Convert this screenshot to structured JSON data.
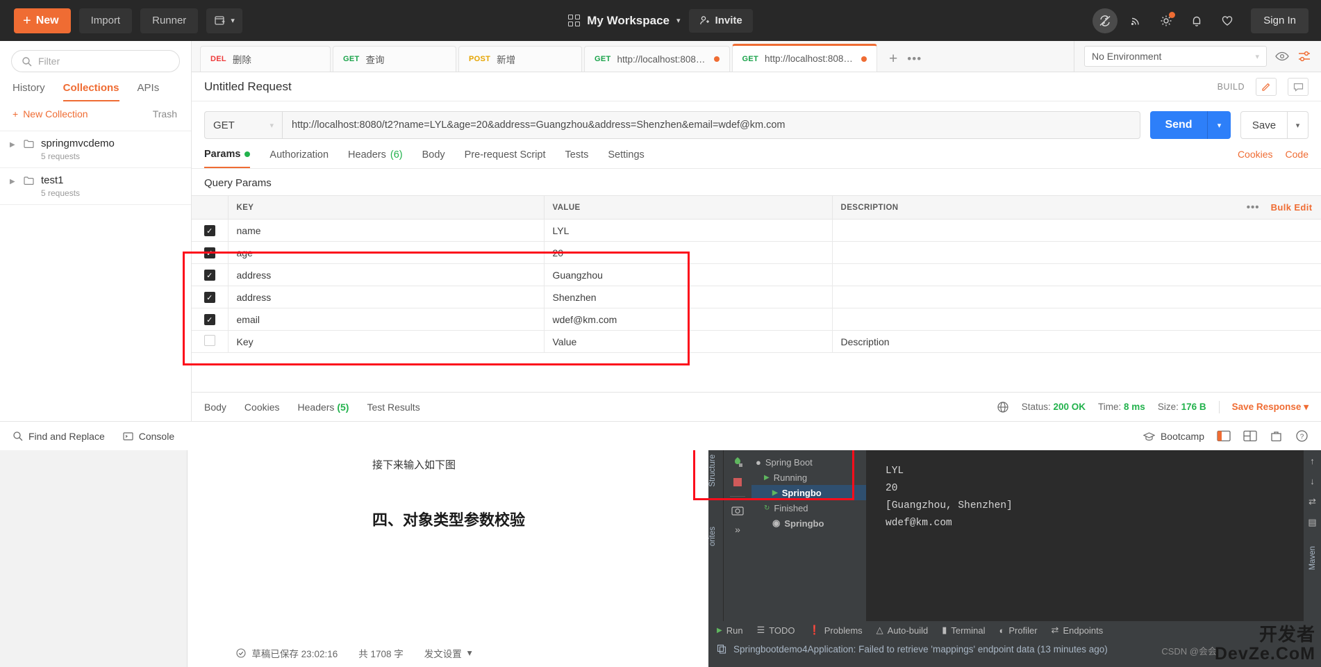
{
  "topbar": {
    "new_label": "New",
    "import_label": "Import",
    "runner_label": "Runner",
    "workspace_label": "My Workspace",
    "invite_label": "Invite",
    "signin_label": "Sign In",
    "icons": [
      "sync-off-icon",
      "broadcast-icon",
      "gear-icon",
      "bell-icon",
      "heart-icon"
    ],
    "accent_color": "#ef6c33",
    "background_color": "#282828"
  },
  "sidebar": {
    "filter_placeholder": "Filter",
    "tabs": [
      {
        "label": "History",
        "active": false
      },
      {
        "label": "Collections",
        "active": true
      },
      {
        "label": "APIs",
        "active": false
      }
    ],
    "new_collection_label": "New Collection",
    "trash_label": "Trash",
    "collections": [
      {
        "name": "springmvcdemo",
        "meta": "5 requests"
      },
      {
        "name": "test1",
        "meta": "5 requests"
      }
    ]
  },
  "request_tabs": [
    {
      "method": "DEL",
      "label": "删除",
      "active": false,
      "unsaved": false
    },
    {
      "method": "GET",
      "label": "查询",
      "active": false,
      "unsaved": false
    },
    {
      "method": "POST",
      "label": "新增",
      "active": false,
      "unsaved": false
    },
    {
      "method": "GET",
      "label": "http://localhost:8080/...",
      "active": false,
      "unsaved": true
    },
    {
      "method": "GET",
      "label": "http://localhost:8080/...",
      "active": true,
      "unsaved": true
    }
  ],
  "tab_add_label": "+",
  "tab_more_label": "•••",
  "environment": {
    "selected": "No Environment",
    "eye_icon": "eye-icon",
    "settings_icon": "sliders-icon"
  },
  "request": {
    "title": "Untitled Request",
    "build_label": "BUILD",
    "method": "GET",
    "url": "http://localhost:8080/t2?name=LYL&age=20&address=Guangzhou&address=Shenzhen&email=wdef@km.com",
    "send_label": "Send",
    "save_label": "Save",
    "tabs": [
      {
        "label": "Params",
        "active": true,
        "dot": true,
        "count": ""
      },
      {
        "label": "Authorization",
        "active": false,
        "dot": false,
        "count": ""
      },
      {
        "label": "Headers",
        "active": false,
        "dot": false,
        "count": "(6)"
      },
      {
        "label": "Body",
        "active": false,
        "dot": false,
        "count": ""
      },
      {
        "label": "Pre-request Script",
        "active": false,
        "dot": false,
        "count": ""
      },
      {
        "label": "Tests",
        "active": false,
        "dot": false,
        "count": ""
      },
      {
        "label": "Settings",
        "active": false,
        "dot": false,
        "count": ""
      }
    ],
    "cookies_label": "Cookies",
    "code_label": "Code"
  },
  "params": {
    "section_title": "Query Params",
    "columns": [
      "KEY",
      "VALUE",
      "DESCRIPTION"
    ],
    "bulk_edit_label": "Bulk Edit",
    "more_label": "•••",
    "rows": [
      {
        "checked": true,
        "key": "name",
        "value": "LYL",
        "description": ""
      },
      {
        "checked": true,
        "key": "age",
        "value": "20",
        "description": ""
      },
      {
        "checked": true,
        "key": "address",
        "value": "Guangzhou",
        "description": ""
      },
      {
        "checked": true,
        "key": "address",
        "value": "Shenzhen",
        "description": ""
      },
      {
        "checked": true,
        "key": "email",
        "value": "wdef@km.com",
        "description": ""
      }
    ],
    "empty_row": {
      "key": "Key",
      "value": "Value",
      "description": "Description"
    },
    "highlight_color": "#fc0d1b"
  },
  "response": {
    "tabs": [
      {
        "label": "Body",
        "count": ""
      },
      {
        "label": "Cookies",
        "count": ""
      },
      {
        "label": "Headers",
        "count": "(5)"
      },
      {
        "label": "Test Results",
        "count": ""
      }
    ],
    "status_label": "Status:",
    "status_value": "200 OK",
    "time_label": "Time:",
    "time_value": "8 ms",
    "size_label": "Size:",
    "size_value": "176 B",
    "save_response_label": "Save Response"
  },
  "bottom_strip": {
    "find_replace_label": "Find and Replace",
    "console_label": "Console",
    "bootcamp_label": "Bootcamp"
  },
  "editor_doc": {
    "line1": "接下来输入如下图",
    "heading": "四、对象类型参数校验",
    "saved_label": "草稿已保存 23:02:16",
    "word_count": "共 1708 字",
    "publish_label": "发文设置"
  },
  "ide": {
    "left_rail": [
      "Structure",
      "orites"
    ],
    "tree": [
      {
        "label": "Spring Boot",
        "selected": false
      },
      {
        "label": "Running",
        "selected": false
      },
      {
        "label": "Springbo",
        "selected": true
      },
      {
        "label": "Finished",
        "selected": false
      },
      {
        "label": "Springbo",
        "selected": false
      }
    ],
    "console_lines": [
      "LYL",
      "20",
      "[Guangzhou, Shenzhen]",
      "wdef@km.com"
    ],
    "bottom_tools": [
      "Run",
      "TODO",
      "Problems",
      "Auto-build",
      "Terminal",
      "Profiler",
      "Endpoints"
    ],
    "status_message": "Springbootdemo4Application: Failed to retrieve 'mappings' endpoint data (13 minutes ago)",
    "right_rail_label": "Maven",
    "highlight_color": "#fc0d1b"
  },
  "watermark": {
    "line1": "开发者",
    "line2": "DevZe.CoM",
    "csdn": "CSDN @会会"
  }
}
